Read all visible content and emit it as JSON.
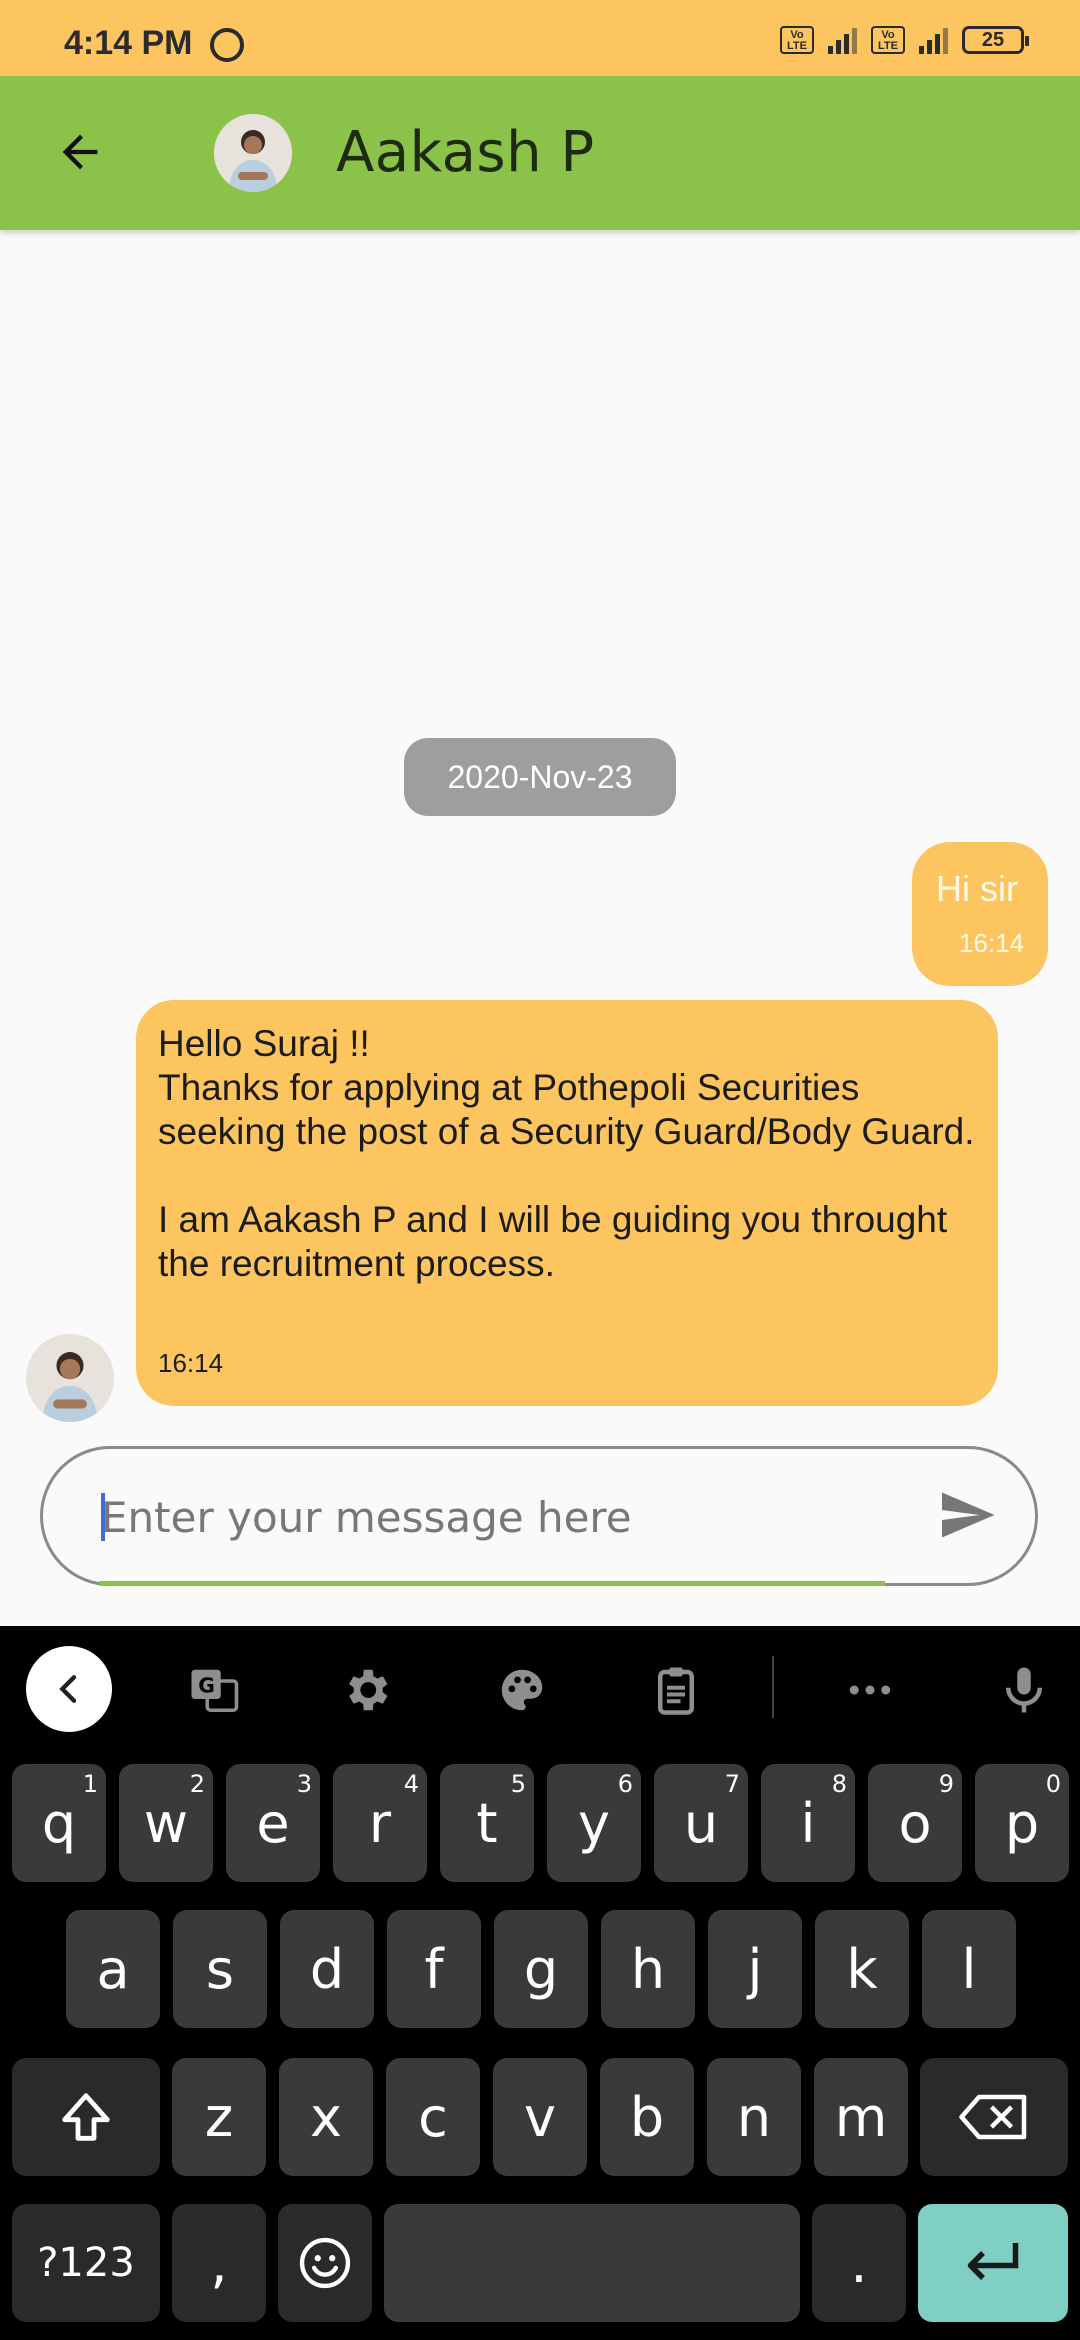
{
  "status_bar": {
    "time": "4:14 PM",
    "battery": "25",
    "volte": "Vo LTE",
    "network": "4G"
  },
  "header": {
    "title": "Aakash P"
  },
  "chat": {
    "date_chip": "2020-Nov-23",
    "messages": [
      {
        "direction": "outgoing",
        "text": "Hi sir",
        "time": "16:14"
      },
      {
        "direction": "incoming",
        "text": "Hello Suraj !!\nThanks for applying at Pothepoli Securities seeking the post of a Security Guard/Body Guard.\n\nI am Aakash P and I will be guiding you throught the recruitment process.",
        "time": "16:14"
      }
    ]
  },
  "composer": {
    "placeholder": "Enter your message here",
    "value": ""
  },
  "keyboard": {
    "row1": [
      {
        "k": "q",
        "h": "1"
      },
      {
        "k": "w",
        "h": "2"
      },
      {
        "k": "e",
        "h": "3"
      },
      {
        "k": "r",
        "h": "4"
      },
      {
        "k": "t",
        "h": "5"
      },
      {
        "k": "y",
        "h": "6"
      },
      {
        "k": "u",
        "h": "7"
      },
      {
        "k": "i",
        "h": "8"
      },
      {
        "k": "o",
        "h": "9"
      },
      {
        "k": "p",
        "h": "0"
      }
    ],
    "row2": [
      "a",
      "s",
      "d",
      "f",
      "g",
      "h",
      "j",
      "k",
      "l"
    ],
    "row3": [
      "z",
      "x",
      "c",
      "v",
      "b",
      "n",
      "m"
    ],
    "symbols_label": "?123",
    "comma": ",",
    "period": "."
  },
  "colors": {
    "status_bar": "#fcc55f",
    "app_bar": "#8bc34a",
    "bubble": "#fcc55f",
    "date_chip": "#9e9e9e",
    "enter_key": "#7fcfc5"
  }
}
